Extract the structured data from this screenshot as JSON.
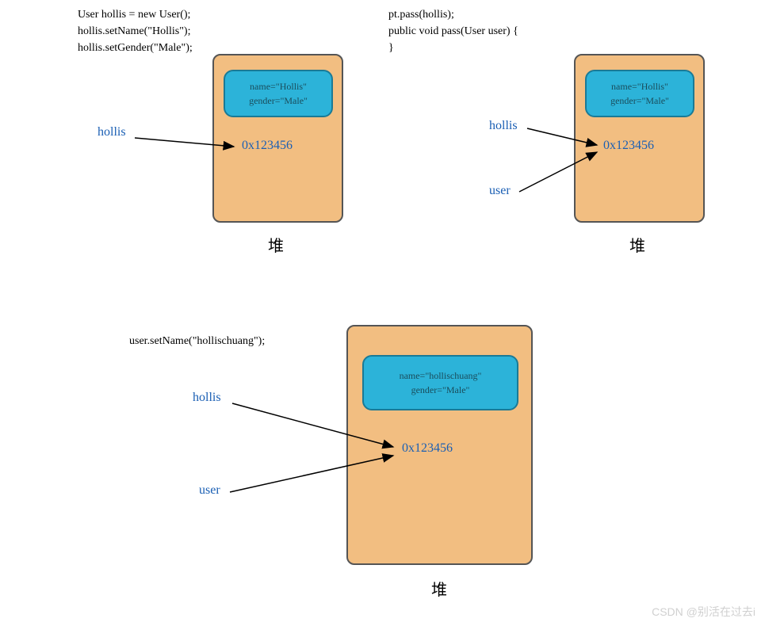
{
  "panel1": {
    "code": "User hollis = new User();\nhollis.setName(\"Hollis\");\nhollis.setGender(\"Male\");",
    "obj_line1": "name=\"Hollis\"",
    "obj_line2": "gender=\"Male\"",
    "address": "0x123456",
    "pointer1": "hollis",
    "heap_label": "堆"
  },
  "panel2": {
    "code": "pt.pass(hollis);\npublic void pass(User user) {\n}",
    "obj_line1": "name=\"Hollis\"",
    "obj_line2": "gender=\"Male\"",
    "address": "0x123456",
    "pointer1": "hollis",
    "pointer2": "user",
    "heap_label": "堆"
  },
  "panel3": {
    "code": "user.setName(\"hollischuang\");",
    "obj_line1": "name=\"hollischuang\"",
    "obj_line2": "gender=\"Male\"",
    "address": "0x123456",
    "pointer1": "hollis",
    "pointer2": "user",
    "heap_label": "堆"
  },
  "watermark": "CSDN @别活在过去i"
}
